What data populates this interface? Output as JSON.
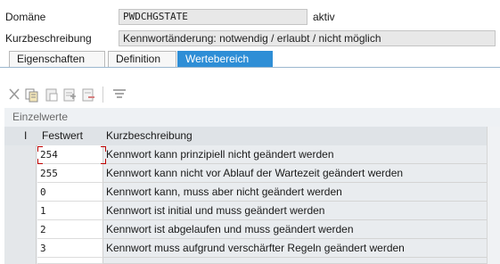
{
  "header": {
    "domain_label": "Domäne",
    "domain_value": "PWDCHGSTATE",
    "domain_status": "aktiv",
    "short_desc_label": "Kurzbeschreibung",
    "short_desc_value": "Kennwortänderung: notwendig / erlaubt / nicht möglich"
  },
  "tabs": [
    {
      "label": "Eigenschaften",
      "active": false
    },
    {
      "label": "Definition",
      "active": false
    },
    {
      "label": "Wertebereich",
      "active": true
    }
  ],
  "toolbar": {
    "icons": [
      "cut-icon",
      "copy-icon",
      "paste-icon",
      "insert-row-icon",
      "delete-row-icon",
      "filter-icon"
    ]
  },
  "values_section": {
    "title": "Einzelwerte",
    "columns": [
      "I",
      "Festwert",
      "Kurzbeschreibung"
    ],
    "rows": [
      {
        "fixed": "254",
        "desc": "Kennwort kann prinzipiell nicht geändert werden"
      },
      {
        "fixed": "255",
        "desc": "Kennwort kann nicht vor Ablauf der Wartezeit geändert werden"
      },
      {
        "fixed": "0",
        "desc": "Kennwort kann, muss aber nicht geändert werden"
      },
      {
        "fixed": "1",
        "desc": "Kennwort ist initial und muss geändert werden"
      },
      {
        "fixed": "2",
        "desc": "Kennwort ist abgelaufen und muss geändert werden"
      },
      {
        "fixed": "3",
        "desc": "Kennwort muss aufgrund verschärfter Regeln geändert werden"
      },
      {
        "fixed": "",
        "desc": ""
      }
    ]
  },
  "colors": {
    "active_tab": "#2e8ed6",
    "cursor_marker": "#c00000"
  }
}
